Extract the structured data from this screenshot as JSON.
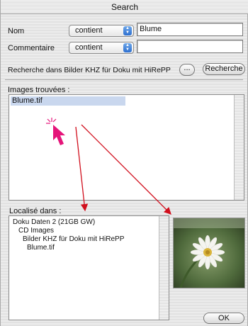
{
  "window": {
    "title": "Search"
  },
  "criteria": {
    "name_label": "Nom",
    "name_operator": "contient",
    "name_value": "Blume",
    "comment_label": "Commentaire",
    "comment_operator": "contient",
    "comment_value": ""
  },
  "search_in": {
    "label": "Recherche dans Bilder KHZ für Doku mit HiRePP",
    "browse_label": "...",
    "search_button": "Recherche"
  },
  "results": {
    "label": "Images trouvées :",
    "items": [
      "Blume.tif"
    ]
  },
  "location": {
    "label": "Localisé dans :",
    "path": [
      "Doku Daten 2 (21GB GW)",
      "CD Images",
      "Bilder KHZ für Doku mit HiRePP",
      "Blume.tif"
    ]
  },
  "footer": {
    "ok_button": "OK"
  },
  "colors": {
    "arrow": "#d10f1d",
    "cursor": "#e5157a",
    "selection": "#c9d7ee"
  }
}
